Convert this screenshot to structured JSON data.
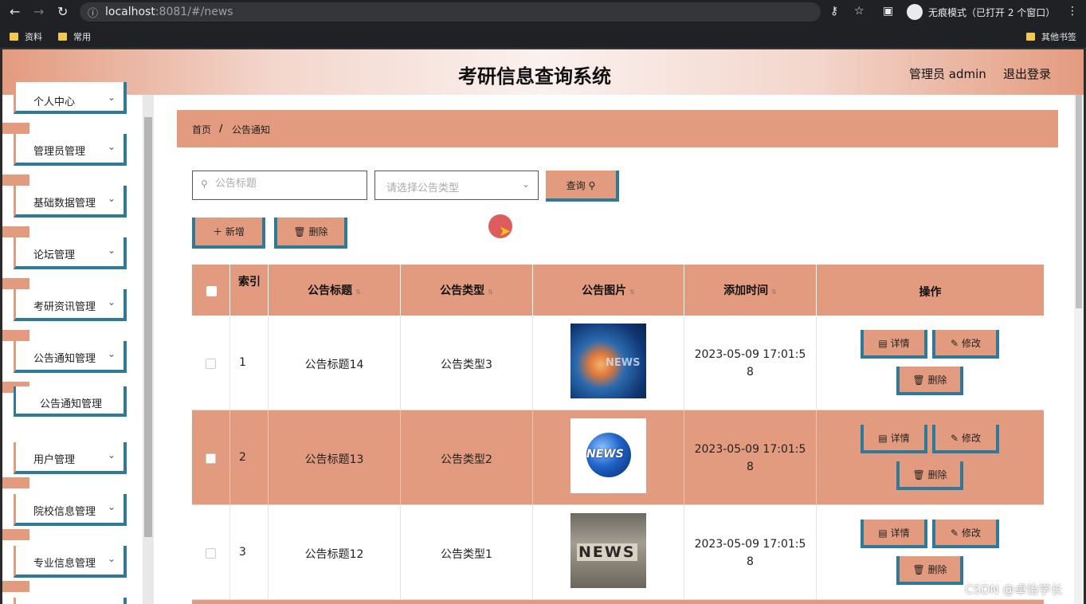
{
  "browser": {
    "url_host": "localhost",
    "url_rest": ":8081/#/news",
    "incognito_text": "无痕模式（已打开 2 个窗口）",
    "bookmarks": [
      "资料",
      "常用"
    ],
    "other_bookmarks": "其他书签"
  },
  "header": {
    "title": "考研信息查询系统",
    "admin_label": "管理员 admin",
    "logout_label": "退出登录"
  },
  "sidebar": {
    "items": [
      {
        "label": "个人中心"
      },
      {
        "label": "管理员管理"
      },
      {
        "label": "基础数据管理"
      },
      {
        "label": "论坛管理"
      },
      {
        "label": "考研资讯管理"
      },
      {
        "label": "公告通知管理"
      },
      {
        "label": "用户管理"
      },
      {
        "label": "院校信息管理"
      },
      {
        "label": "专业信息管理"
      }
    ],
    "active_sub": "公告通知管理"
  },
  "breadcrumb": {
    "home": "首页",
    "sep": "/",
    "current": "公告通知"
  },
  "search": {
    "title_placeholder": "公告标题",
    "type_placeholder": "请选择公告类型",
    "query_label": "查询"
  },
  "actions": {
    "add_label": "新增",
    "delete_label": "删除"
  },
  "table": {
    "headers": [
      "索引",
      "公告标题",
      "公告类型",
      "公告图片",
      "添加时间",
      "操作"
    ],
    "rows": [
      {
        "index": "1",
        "title": "公告标题14",
        "type": "公告类型3",
        "time_line1": "2023-05-09 17:01:5",
        "time_line2": "8"
      },
      {
        "index": "2",
        "title": "公告标题13",
        "type": "公告类型2",
        "time_line1": "2023-05-09 17:01:5",
        "time_line2": "8"
      },
      {
        "index": "3",
        "title": "公告标题12",
        "type": "公告类型1",
        "time_line1": "2023-05-09 17:01:5",
        "time_line2": "8"
      }
    ],
    "op_detail": "详情",
    "op_edit": "修改",
    "op_delete": "删除"
  },
  "image_text": {
    "row1": "NEWS",
    "row2": "NEWS",
    "row3": "NEWS"
  },
  "watermark": "CSDN @卓怡学长",
  "colors": {
    "accent": "#e39b7f",
    "border": "#2f7a98"
  }
}
